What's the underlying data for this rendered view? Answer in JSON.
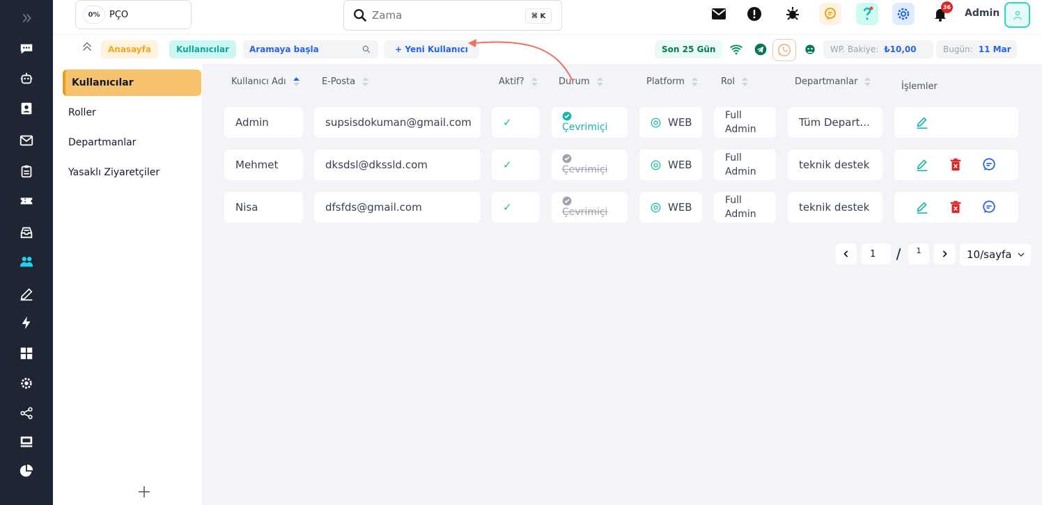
{
  "rail": {
    "items": [
      "expand-icon",
      "chat-icon",
      "bot-icon",
      "contact-card-icon",
      "mail-icon",
      "clipboard-icon",
      "ticket-icon",
      "inbox-icon",
      "users-icon",
      "edit-icon",
      "bolt-icon",
      "grid-icon",
      "settings-icon",
      "share-icon",
      "device-icon",
      "pie-chart-icon"
    ],
    "active": "users-icon"
  },
  "topbar": {
    "pco_percent": "0%",
    "pco_label": "PÇO",
    "search_placeholder": "Zama",
    "search_shortcut": "⌘ K",
    "notification_count": "36",
    "user_name": "Admin"
  },
  "breadcrumb": {
    "home": "Anasayfa",
    "current": "Kullanıcılar",
    "search_placeholder": "Aramaya başla",
    "new_user": "+ Yeni Kullanıcı",
    "range": "Son 25 Gün",
    "wp_balance_label": "WP. Bakiye:",
    "wp_balance_value": "₺10,00",
    "today_label": "Bugün:",
    "today_value": "11 Mar"
  },
  "menu": {
    "items": [
      "Kullanıcılar",
      "Roller",
      "Departmanlar",
      "Yasaklı Ziyaretçiler"
    ],
    "add_label": "+"
  },
  "table": {
    "headers": {
      "username": "Kullanıcı Adı",
      "email": "E-Posta",
      "active": "Aktif?",
      "status": "Durum",
      "platform": "Platform",
      "role": "Rol",
      "departments": "Departmanlar",
      "actions": "İşlemler"
    },
    "rows": [
      {
        "username": "Admin",
        "email": "supsisdokuman@gmail.com",
        "active": "✓",
        "status": "Çevrimiçi",
        "online": true,
        "platform": "WEB",
        "role_line1": "Full",
        "role_line2": "Admin",
        "departments": "Tüm Depart...",
        "can_delete": false
      },
      {
        "username": "Mehmet",
        "email": "dksdsl@dkssld.com",
        "active": "✓",
        "status": "Çevrimiçi",
        "online": false,
        "platform": "WEB",
        "role_line1": "Full",
        "role_line2": "Admin",
        "departments": "teknik destek",
        "can_delete": true
      },
      {
        "username": "Nisa",
        "email": "dfsfds@gmail.com",
        "active": "✓",
        "status": "Çevrimiçi",
        "online": false,
        "platform": "WEB",
        "role_line1": "Full",
        "role_line2": "Admin",
        "departments": "teknik destek",
        "can_delete": true
      }
    ]
  },
  "pagination": {
    "current_page": "1",
    "separator": "/",
    "total_pages": "1",
    "page_size": "10/sayfa"
  },
  "colors": {
    "rail_bg": "#1e2533",
    "accent_active": "#f7c36e",
    "teal": "#14b8a6",
    "blue": "#2563eb",
    "delete_red": "#dc2626",
    "annotation_arrow": "#f0705a"
  }
}
